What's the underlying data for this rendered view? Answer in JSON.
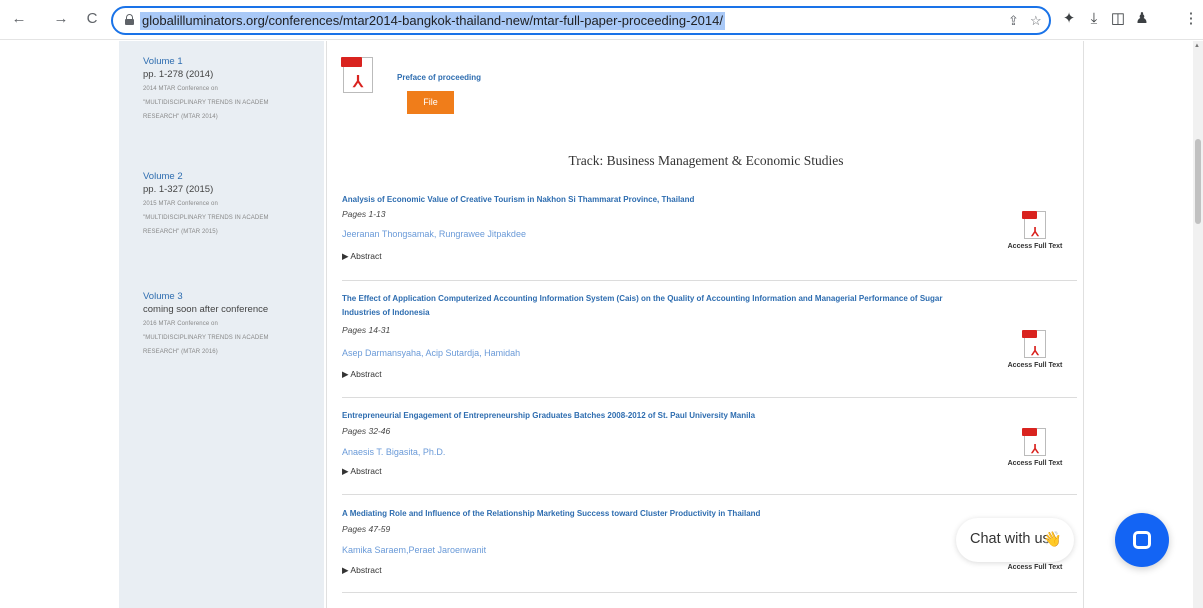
{
  "browser": {
    "back_glyph": "←",
    "forward_glyph": "→",
    "reload_glyph": "C",
    "url": "globalilluminators.org/conferences/mtar2014-bangkok-thailand-new/mtar-full-paper-proceeding-2014/",
    "icons": [
      "share-icon",
      "star-icon",
      "extensions-icon",
      "download-icon",
      "sidepanel-icon",
      "profile-icon",
      "menu-icon"
    ]
  },
  "sidebar": {
    "volumes": [
      {
        "title": "Volume 1",
        "pages": "pp. 1-278 (2014)",
        "desc": [
          "2014 MTAR Conference on",
          "\"MULTIDISCIPLINARY TRENDS IN ACADEM",
          "RESEARCH\" (MTAR 2014)"
        ]
      },
      {
        "title": "Volume 2",
        "pages": "pp. 1-327 (2015)",
        "desc": [
          "2015 MTAR Conference on",
          "\"MULTIDISCIPLINARY TRENDS IN ACADEM",
          "RESEARCH\" (MTAR 2015)"
        ]
      },
      {
        "title": "Volume 3",
        "pages": "coming soon after conference",
        "desc": [
          "2016 MTAR Conference on",
          "\"MULTIDISCIPLINARY TRENDS IN ACADEM",
          "RESEARCH\" (MTAR 2016)"
        ]
      }
    ]
  },
  "content": {
    "preface_label": "Preface of proceeding",
    "file_button": "File",
    "track_title": "Track: Business Management & Economic Studies",
    "access_label": "Access Full Text",
    "abstract_label": "▶ Abstract",
    "entries": [
      {
        "title": "Analysis of Economic Value of Creative Tourism in Nakhon Si Thammarat Province, Thailand",
        "pages": "Pages 1-13",
        "authors": "Jeeranan Thongsamak, Rungrawee Jitpakdee"
      },
      {
        "title": "The Effect of Application Computerized Accounting Information System (Cais) on the Quality of Accounting Information and Managerial Performance of Sugar Industries of Indonesia",
        "pages": "Pages 14-31",
        "authors": "Asep Darmansyaha, Acip Sutardja, Hamidah"
      },
      {
        "title": "Entrepreneurial Engagement of Entrepreneurship Graduates Batches 2008-2012 of St. Paul University Manila",
        "pages": "Pages 32-46",
        "authors": "Anaesis T. Bigasita, Ph.D."
      },
      {
        "title": "A Mediating Role and Influence of the Relationship Marketing Success toward Cluster Productivity in Thailand",
        "pages": "Pages 47-59",
        "authors": "Kamika Saraem,Peraet Jaroenwanit"
      }
    ]
  },
  "chat": {
    "label": "Chat with us",
    "wave": "👋"
  },
  "colors": {
    "link": "#2e6db0",
    "author": "#6a9ad8",
    "file_button": "#f07d1a",
    "chat_button": "#1364f4",
    "pdf_red": "#d9231f"
  }
}
